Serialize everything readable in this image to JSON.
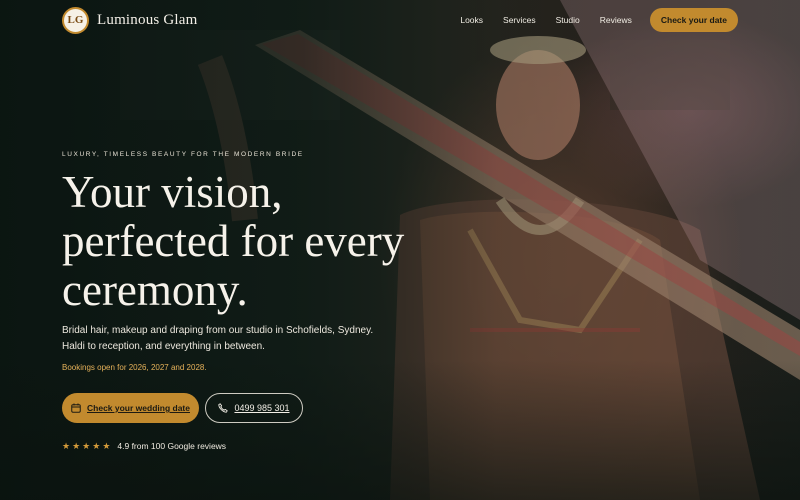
{
  "brand": {
    "name": "Luminous Glam",
    "logo_icon": "lg-monogram-icon",
    "logo_text": "LG"
  },
  "nav": {
    "items": [
      {
        "label": "Looks"
      },
      {
        "label": "Services"
      },
      {
        "label": "Studio"
      },
      {
        "label": "Reviews"
      }
    ],
    "cta_label": "Check your date"
  },
  "hero": {
    "eyebrow": "LUXURY, TIMELESS BEAUTY FOR THE MODERN BRIDE",
    "headline_lines": [
      "Your vision,",
      "perfected for every",
      "ceremony."
    ],
    "sub_lines": [
      "Bridal hair, makeup and draping from our studio in Schofields, Sydney.",
      "Haldi to reception, and everything in between."
    ],
    "bookings": "Bookings open for 2026, 2027 and 2028.",
    "primary_button": {
      "label": "Check your wedding date",
      "icon": "calendar-icon"
    },
    "secondary_button": {
      "label": "0499 985 301",
      "icon": "phone-icon"
    },
    "rating": {
      "stars": 5,
      "star_icon": "star-icon",
      "text": "4.9 from 100 Google reviews"
    }
  },
  "colors": {
    "accent": "#c28a2e",
    "bookings_text": "#e6b25a",
    "background": "#16221c"
  }
}
